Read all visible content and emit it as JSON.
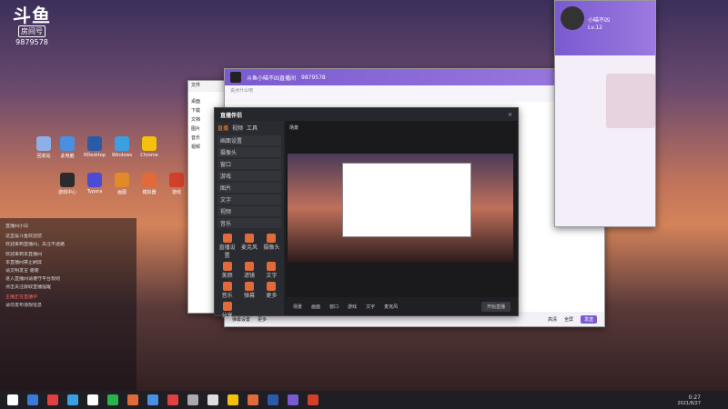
{
  "watermark": {
    "logo": "斗鱼",
    "room_label": "房间号",
    "room_number": "9879578"
  },
  "desktop_icons": [
    {
      "label": "回收站",
      "color": "#8fb0e6"
    },
    {
      "label": "此电脑",
      "color": "#4a90e2"
    },
    {
      "label": "RDesktop",
      "color": "#2b5aa8"
    },
    {
      "label": "Windows",
      "color": "#3aa0e0"
    },
    {
      "label": "Chrome",
      "color": "#f4c20d"
    },
    {
      "label": "游戏中心",
      "color": "#2b2b2b"
    },
    {
      "label": "Typora",
      "color": "#4b4bd6"
    },
    {
      "label": "画图",
      "color": "#e08a2a"
    },
    {
      "label": "模拟器",
      "color": "#e06a3a"
    },
    {
      "label": "游戏",
      "color": "#d0402a"
    }
  ],
  "chat": {
    "lines": [
      "直播间小白",
      "",
      "这里是斗鱼欢迎您",
      "欢迎来到直播间，关注不迷路",
      "",
      "欢迎来到本直播间",
      "本直播间禁止刷屏",
      "请文明发言 谢谢",
      "进入直播间请遵守平台规则",
      "点击关注获取直播提醒",
      "",
      "主播正在直播中",
      "请勿发布违规信息"
    ],
    "highlight": "主播正在直播"
  },
  "stream_window": {
    "title": "斗鱼小喵不凶直播间",
    "room": "9879578",
    "input_placeholder": "说点什么吧",
    "send_label": "发送",
    "footer_left": "弹幕设置",
    "footer_mid": "更多",
    "footer_right1": "高清",
    "footer_right2": "全屏"
  },
  "helper_window": {
    "title": "直播伴侣",
    "tabs": [
      "直播",
      "视频",
      "工具"
    ],
    "scene_title": "场景",
    "menu": [
      "画面设置",
      "摄像头",
      "窗口",
      "游戏",
      "图片",
      "文字",
      "视频",
      "音乐"
    ],
    "tools": [
      "直播设置",
      "麦克风",
      "摄像头",
      "美颜",
      "滤镜",
      "文字",
      "音乐",
      "弹幕",
      "更多",
      "分享"
    ],
    "bottom_items": [
      "场景",
      "画面",
      "窗口",
      "游戏",
      "文字",
      "麦克风"
    ],
    "start_label": "开始直播"
  },
  "explorer": {
    "title": "文件",
    "items": [
      "桌面",
      "下载",
      "文档",
      "图片",
      "音乐",
      "视频"
    ]
  },
  "profile": {
    "name": "小喵不凶",
    "level": "Lv.12"
  },
  "clock": {
    "time": "0:27",
    "date": "2021/8/27"
  }
}
